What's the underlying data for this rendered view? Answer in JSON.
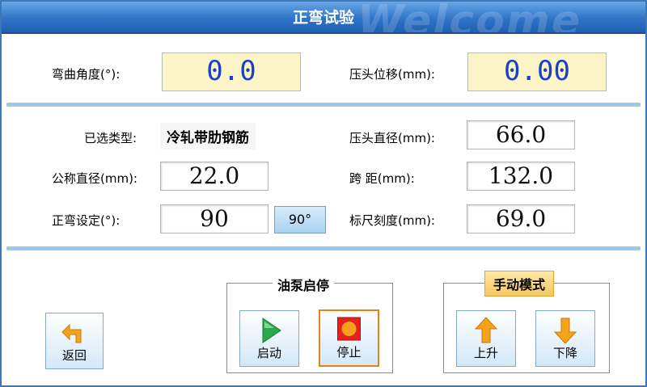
{
  "title": "正弯试验",
  "watermark": "Welcome",
  "top": {
    "bend_angle_label": "弯曲角度(°):",
    "bend_angle_value": "0.0",
    "press_disp_label": "压头位移(mm):",
    "press_disp_value": "0.00"
  },
  "params": {
    "type_label": "已选类型:",
    "type_value": "冷轧带肋钢筋",
    "press_dia_label": "压头直径(mm):",
    "press_dia_value": "66.0",
    "nominal_dia_label": "公称直径(mm):",
    "nominal_dia_value": "22.0",
    "span_label": "跨  距(mm):",
    "span_value": "132.0",
    "bend_set_label": "正弯设定(°):",
    "bend_set_value": "90",
    "bend_preset_button": "90°",
    "scale_label": "标尺刻度(mm):",
    "scale_value": "69.0"
  },
  "pump": {
    "group_title": "油泵启停",
    "start_label": "启动",
    "stop_label": "停止"
  },
  "manual": {
    "group_title": "手动模式",
    "up_label": "上升",
    "down_label": "下降"
  },
  "back_label": "返回",
  "colors": {
    "title_bar": "#2f74c8",
    "big_value_bg": "#fdf4c8",
    "big_value_text": "#1a3fc8",
    "separator": "#9cc6ea",
    "play_green": "#2aa84a",
    "stop_red": "#e8201f",
    "arrow_orange": "#f5a31a"
  }
}
